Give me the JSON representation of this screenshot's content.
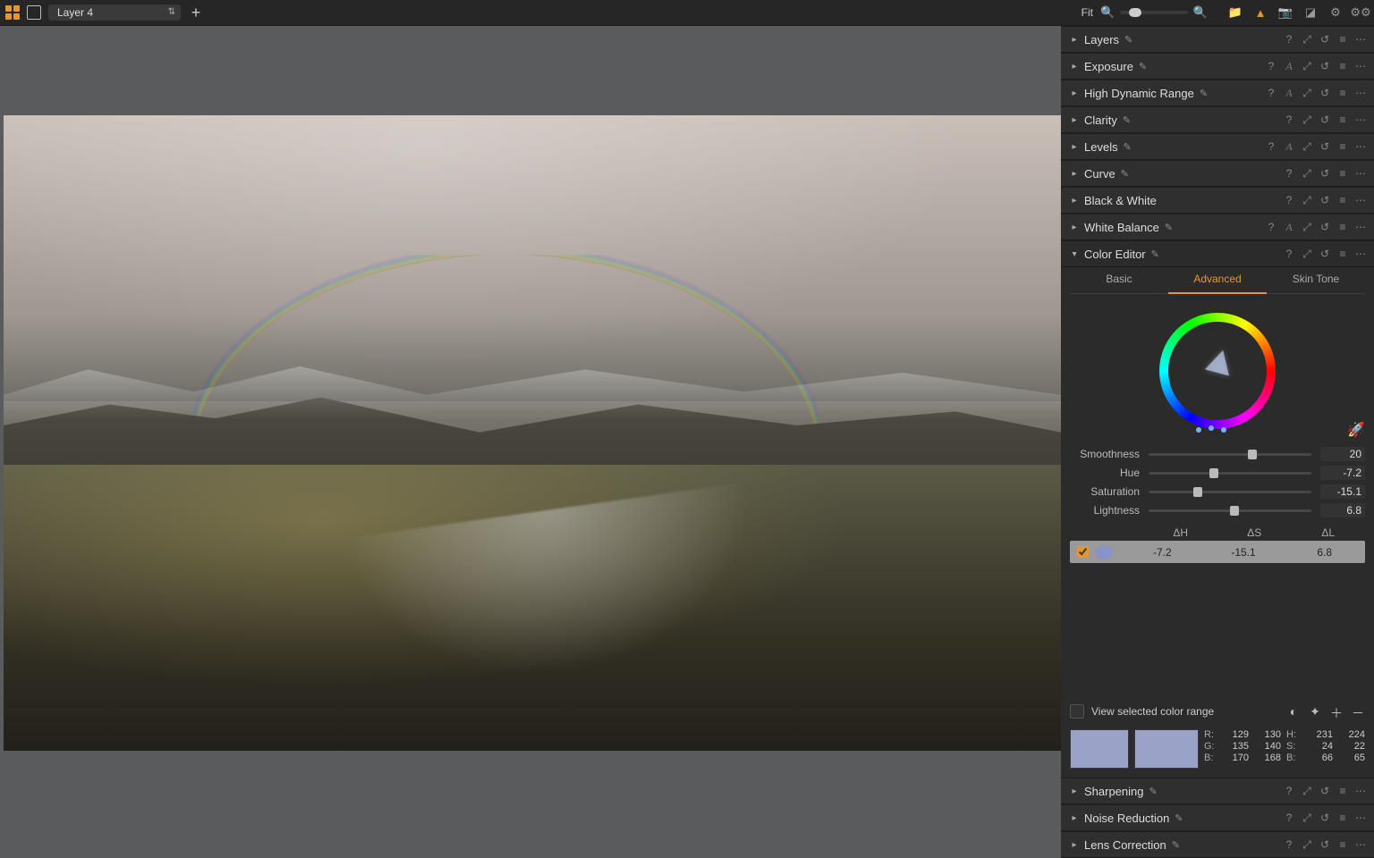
{
  "topbar": {
    "layer_label": "Layer 4",
    "fit_label": "Fit"
  },
  "panels": [
    {
      "title": "Layers",
      "brush": true,
      "extras": [
        "?",
        "↩",
        "↪",
        "≡",
        "…"
      ]
    },
    {
      "title": "Exposure",
      "brush": true,
      "extras": [
        "?",
        "A",
        "↩",
        "↪",
        "≡",
        "…"
      ]
    },
    {
      "title": "High Dynamic Range",
      "brush": true,
      "extras": [
        "?",
        "A",
        "↩",
        "↪",
        "≡",
        "…"
      ]
    },
    {
      "title": "Clarity",
      "brush": true,
      "extras": [
        "?",
        "↩",
        "↪",
        "≡",
        "…"
      ]
    },
    {
      "title": "Levels",
      "brush": true,
      "extras": [
        "?",
        "A",
        "↩",
        "↪",
        "≡",
        "…"
      ]
    },
    {
      "title": "Curve",
      "brush": true,
      "extras": [
        "?",
        "↩",
        "↪",
        "≡",
        "…"
      ]
    },
    {
      "title": "Black & White",
      "brush": false,
      "extras": [
        "?",
        "↩",
        "↪",
        "≡",
        "…"
      ]
    },
    {
      "title": "White Balance",
      "brush": true,
      "extras": [
        "?",
        "A",
        "↩",
        "↪",
        "≡",
        "…"
      ]
    }
  ],
  "color_editor": {
    "title": "Color Editor",
    "tabs": {
      "basic": "Basic",
      "advanced": "Advanced",
      "skin": "Skin Tone"
    },
    "sliders": {
      "smoothness": {
        "label": "Smoothness",
        "value": "20",
        "pos": 64
      },
      "hue": {
        "label": "Hue",
        "value": "-7.2",
        "pos": 40
      },
      "saturation": {
        "label": "Saturation",
        "value": "-15.1",
        "pos": 30
      },
      "lightness": {
        "label": "Lightness",
        "value": "6.8",
        "pos": 53
      }
    },
    "delta_head": {
      "h": "ΔH",
      "s": "ΔS",
      "l": "ΔL"
    },
    "delta_row": {
      "h": "-7.2",
      "s": "-15.1",
      "l": "6.8"
    },
    "view_range_label": "View selected color range",
    "readout": {
      "r": [
        "129",
        "130"
      ],
      "g": [
        "135",
        "140"
      ],
      "b": [
        "170",
        "168"
      ],
      "h": [
        "231",
        "224"
      ],
      "s": [
        "24",
        "22"
      ],
      "b2": [
        "66",
        "65"
      ]
    }
  },
  "bottom_panels": [
    {
      "title": "Sharpening",
      "brush": true
    },
    {
      "title": "Noise Reduction",
      "brush": true
    },
    {
      "title": "Lens Correction",
      "brush": true
    }
  ]
}
